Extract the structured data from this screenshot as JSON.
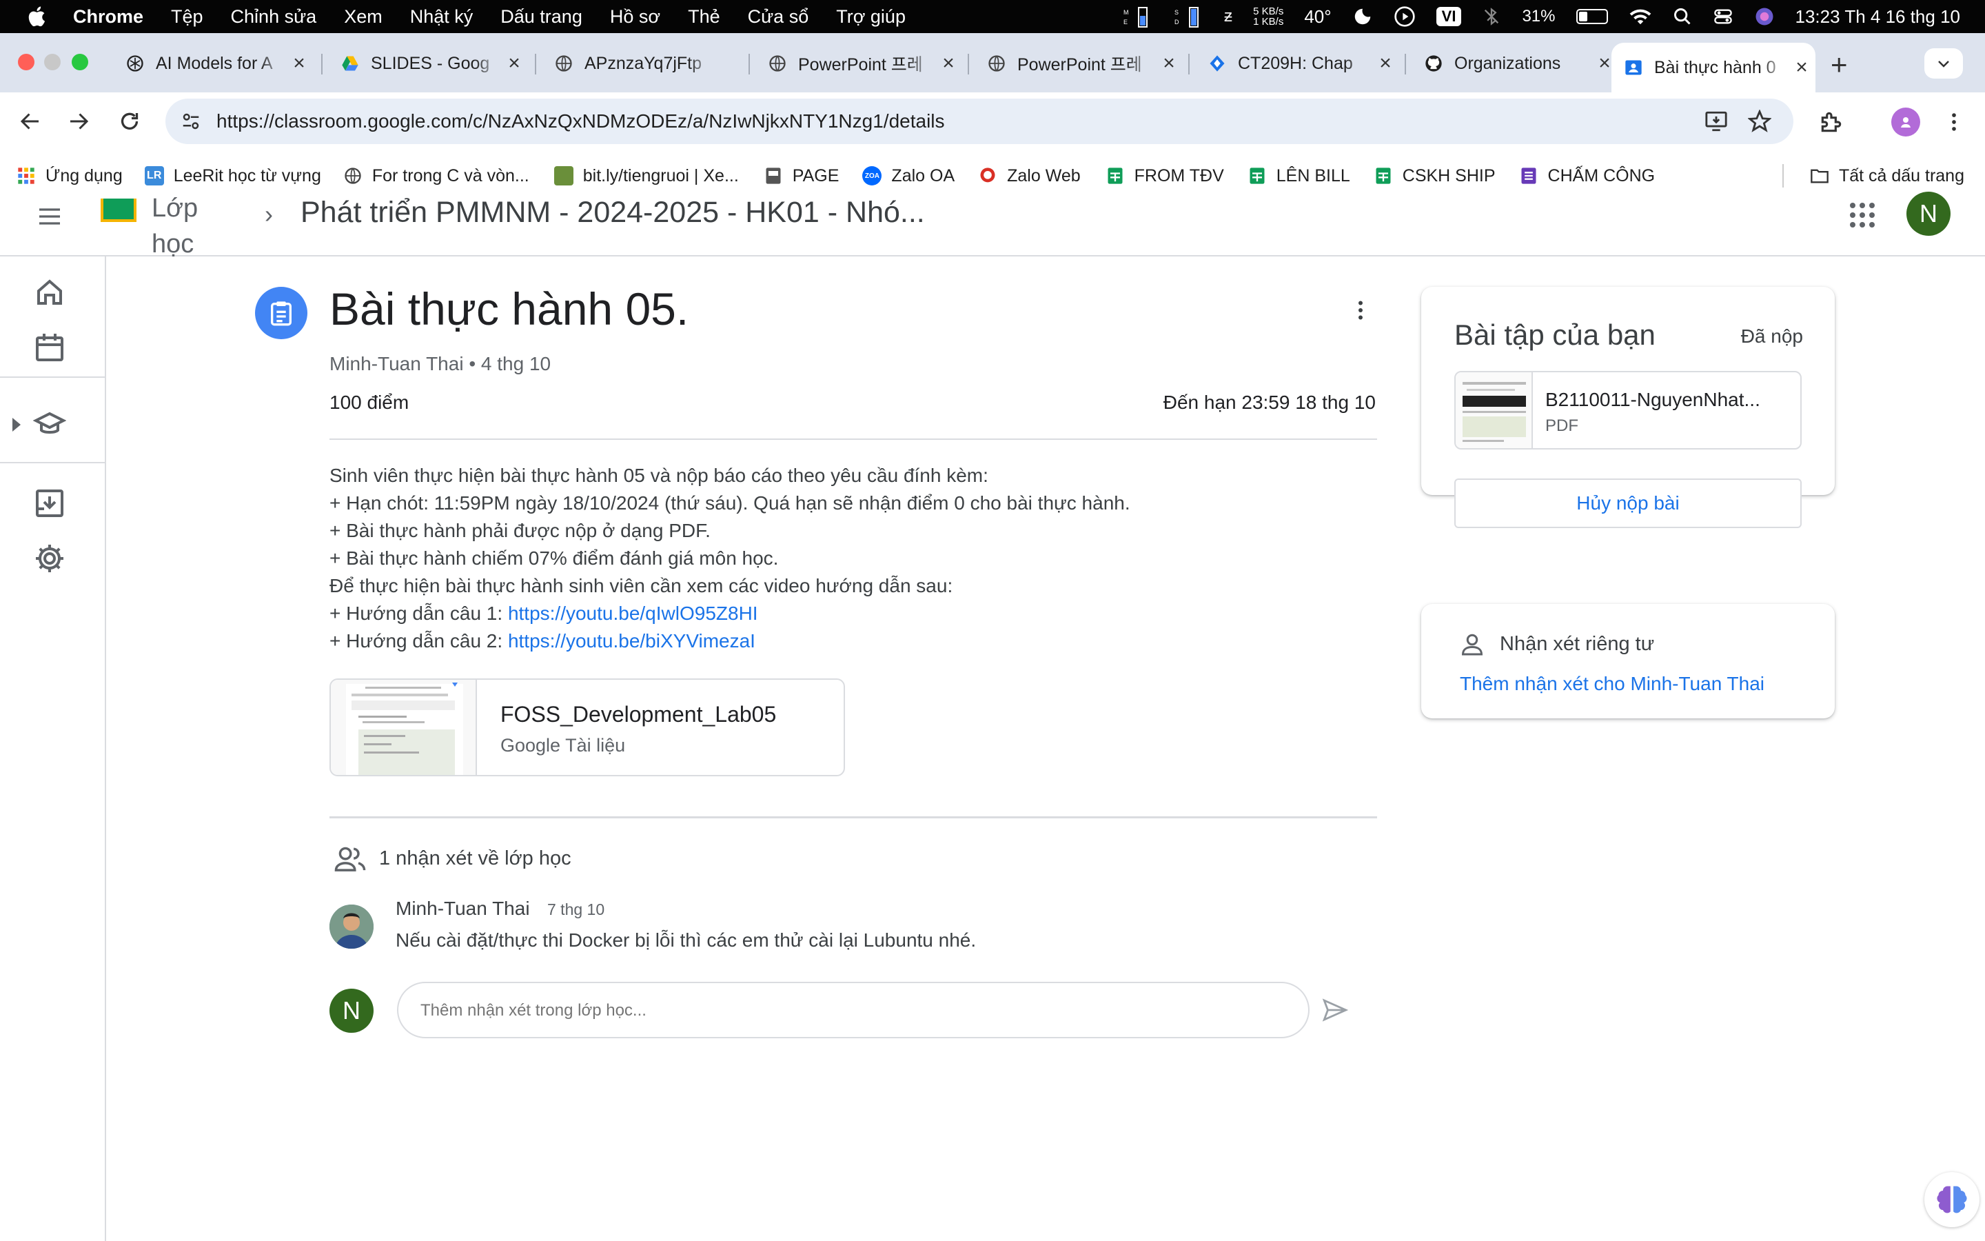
{
  "menubar": {
    "app": "Chrome",
    "items": [
      "Tệp",
      "Chỉnh sửa",
      "Xem",
      "Nhật ký",
      "Dấu trang",
      "Hồ sơ",
      "Thẻ",
      "Cửa sổ",
      "Trợ giúp"
    ],
    "net_up": "5 KB/s",
    "net_down": "1 KB/s",
    "temp": "40°",
    "input_method": "VI",
    "battery": "31%",
    "clock": "13:23 Th 4 16 thg 10"
  },
  "tabs": [
    {
      "title": "AI Models for A",
      "icon": "openai-icon"
    },
    {
      "title": "SLIDES - Goog",
      "icon": "google-drive-icon"
    },
    {
      "title": "APznzaYq7jFtp",
      "icon": "globe-icon"
    },
    {
      "title": "PowerPoint 프레",
      "icon": "globe-icon"
    },
    {
      "title": "PowerPoint 프레",
      "icon": "globe-icon"
    },
    {
      "title": "CT209H: Chap",
      "icon": "diamond-icon"
    },
    {
      "title": "Organizations",
      "icon": "github-icon"
    },
    {
      "title": "Bài thực hành 0",
      "icon": "classroom-icon",
      "active": true
    }
  ],
  "address": {
    "url": "https://classroom.google.com/c/NzAxNzQxNDMzODEz/a/NzIwNjkxNTY1Nzg1/details"
  },
  "bookmarks": [
    {
      "label": "Ứng dụng",
      "icon": "apps-grid-icon"
    },
    {
      "label": "LeeRit học từ vựng",
      "icon": "leerit-icon"
    },
    {
      "label": "For trong C và vòn...",
      "icon": "globe-icon"
    },
    {
      "label": "bit.ly/tiengruoi | Xe...",
      "icon": "site-icon"
    },
    {
      "label": "PAGE",
      "icon": "page-icon"
    },
    {
      "label": "Zalo OA",
      "icon": "zalo-icon"
    },
    {
      "label": "Zalo Web",
      "icon": "zalo-web-icon"
    },
    {
      "label": "FROM TĐV",
      "icon": "sheets-icon"
    },
    {
      "label": "LÊN BILL",
      "icon": "sheets-icon"
    },
    {
      "label": "CSKH SHIP",
      "icon": "sheets-icon"
    },
    {
      "label": "CHẤM CÔNG",
      "icon": "forms-icon"
    }
  ],
  "bookmarks_all": "Tất cả dấu trang",
  "classroom": {
    "logo_text": "Lớp học",
    "breadcrumb": "Phát triển PMMNM - 2024-2025 - HK01 - Nhó...",
    "user_initial": "N"
  },
  "assignment": {
    "title": "Bài thực hành 05.",
    "meta": "Minh-Tuan Thai • 4 thg 10",
    "points": "100 điểm",
    "due": "Đến hạn 23:59 18 thg 10",
    "description": [
      "Sinh viên thực hiện bài thực hành 05 và nộp báo cáo theo yêu cầu đính kèm:",
      "+ Hạn chót: 11:59PM ngày 18/10/2024 (thứ sáu). Quá hạn sẽ nhận điểm 0 cho bài thực hành.",
      "+ Bài thực hành phải được nộp ở dạng PDF.",
      "+ Bài thực hành chiếm 07% điểm đánh giá môn học.",
      "Để thực hiện bài thực hành sinh viên cần xem các video hướng dẫn sau:"
    ],
    "link1_prefix": "+ Hướng dẫn câu 1: ",
    "link1": "https://youtu.be/qIwlO95Z8HI",
    "link2_prefix": "+ Hướng dẫn câu 2: ",
    "link2": "https://youtu.be/biXYVimezaI",
    "attachment": {
      "name": "FOSS_Development_Lab05",
      "type": "Google Tài liệu"
    }
  },
  "class_comments": {
    "heading": "1 nhận xét về lớp học",
    "items": [
      {
        "author": "Minh-Tuan Thai",
        "date": "7 thg 10",
        "text": "Nếu cài đặt/thực thi Docker bị lỗi thì các em thử cài lại Lubuntu nhé."
      }
    ],
    "input_placeholder": "Thêm nhận xét trong lớp học..."
  },
  "your_work": {
    "title": "Bài tập của bạn",
    "status": "Đã nộp",
    "file_name": "B2110011-NguyenNhat...",
    "file_type": "PDF",
    "unsubmit_label": "Hủy nộp bài"
  },
  "private_comments": {
    "heading": "Nhận xét riêng tư",
    "add_link": "Thêm nhận xét cho Minh-Tuan Thai"
  },
  "colors": {
    "accent_blue": "#1a73e8",
    "assignment_icon_bg": "#4285f4",
    "avatar_green": "#33691e",
    "tabstrip_bg": "#dde3ee",
    "omnibox_bg": "#e8eef7"
  }
}
